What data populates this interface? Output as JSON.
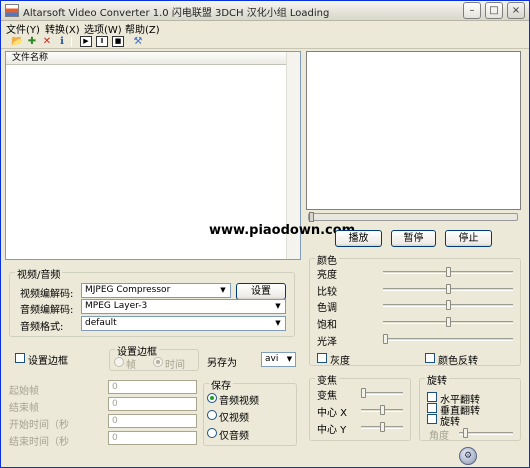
{
  "window": {
    "title": "Altarsoft Video Converter 1.0 闪电联盟 3DCH 汉化小组 Loading",
    "minimize_symbol": "–",
    "maximize_symbol": "□",
    "close_symbol": "×"
  },
  "menu": [
    "文件(Y)",
    "转换(X)",
    "选项(W)",
    "帮助(Z)"
  ],
  "toolbar": {
    "icons": [
      "open-folder-icon",
      "add-icon",
      "delete-icon",
      "info-icon",
      "play-icon",
      "pause-icon",
      "stop-icon",
      "tools-icon"
    ],
    "glyphs": {
      "open": "📂",
      "add": "✚",
      "delete": "✕",
      "info": "ℹ",
      "play": "▶",
      "pause": "Ⅱ",
      "stop": "■",
      "tools": "⚒"
    },
    "colors": {
      "add": "#2a8a23",
      "delete": "#c62a1d"
    }
  },
  "file_list": {
    "column_header": "文件名称"
  },
  "player": {
    "play_label": "播放",
    "pause_label": "暂停",
    "stop_label": "停止"
  },
  "watermark": "www.piaodown.com",
  "video_audio": {
    "group_title": "视频/音频",
    "video_codec_label": "视频编解码:",
    "video_codec_value": "MJPEG Compressor",
    "settings_label": "设置",
    "audio_codec_label": "音频编解码:",
    "audio_codec_value": "MPEG Layer-3",
    "audio_format_label": "音频格式:",
    "audio_format_value": "default"
  },
  "border": {
    "set_border_label": "设置边框",
    "group_title": "设置边框",
    "frame_label": "帧",
    "time_label": "时间"
  },
  "save_as": {
    "label": "另存为",
    "value": "avi"
  },
  "trim": {
    "start_frame_label": "起始帧",
    "end_frame_label": "结束帧",
    "start_time_label": "开始时间（秒",
    "end_time_label": "结束时间（秒",
    "start_frame_value": "0",
    "end_frame_value": "0",
    "start_time_value": "0",
    "end_time_value": "0"
  },
  "save": {
    "group_title": "保存",
    "audio_video_label": "音频视频",
    "video_only_label": "仅视频",
    "audio_only_label": "仅音频"
  },
  "color": {
    "group_title": "颜色",
    "brightness_label": "亮度",
    "contrast_label": "比较",
    "hue_label": "色调",
    "saturation_label": "饱和",
    "gloss_label": "光泽",
    "brightness_level": 0.5,
    "contrast_level": 0.5,
    "hue_level": 0.5,
    "saturation_level": 0.5,
    "gloss_level": 0.0,
    "grayscale_label": "灰度",
    "invert_label": "颜色反转"
  },
  "zoom": {
    "group_title": "变焦",
    "zoom_label": "变焦",
    "center_x_label": "中心 X",
    "center_y_label": "中心 Y",
    "zoom_level": 0.0,
    "center_x_level": 0.5,
    "center_y_level": 0.5
  },
  "rotate": {
    "group_title": "旋转",
    "flip_h_label": "水平翻转",
    "flip_v_label": "垂直翻转",
    "rotate_label": "旋转",
    "angle_label": "角度"
  }
}
